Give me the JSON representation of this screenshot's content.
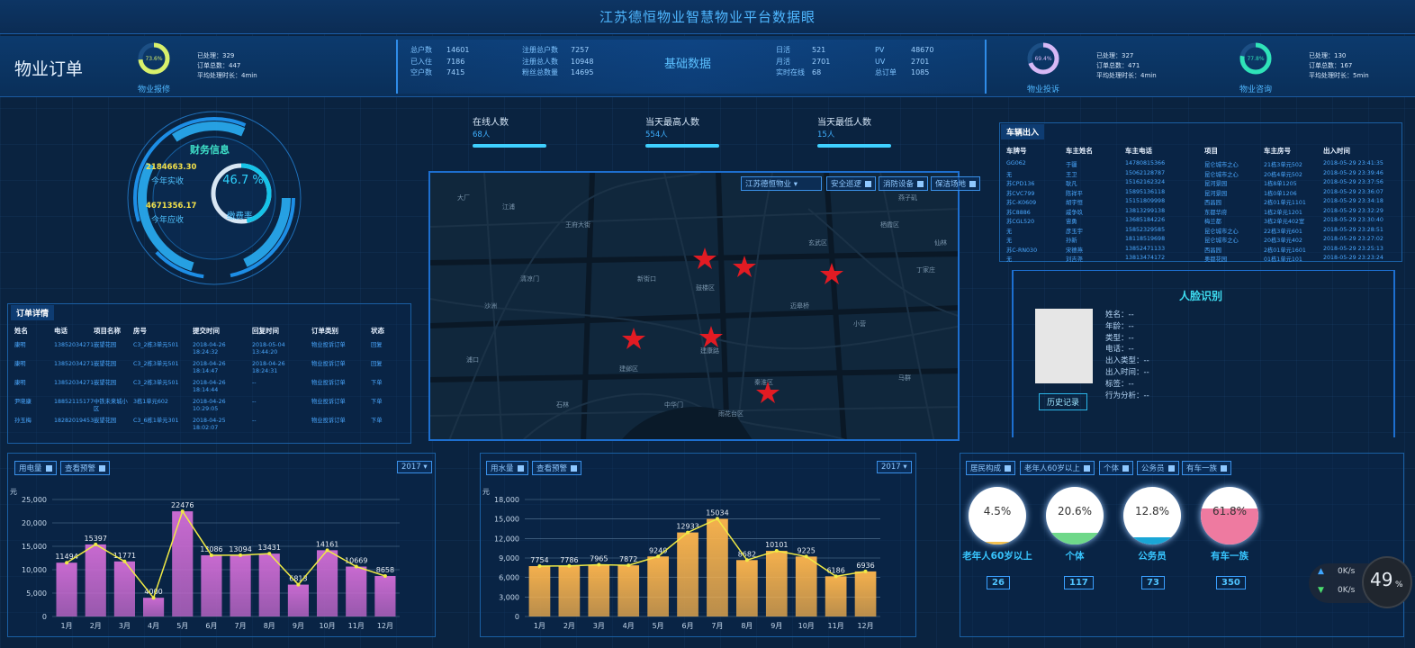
{
  "title": "江苏德恒物业智慧物业平台数据眼",
  "header": {
    "section_title": "物业订单",
    "repair": {
      "pct_text": "73.6%",
      "pct": 0.736,
      "label": "物业报修",
      "color": "#d8f06b",
      "lines": [
        "已处理：329",
        "订单总数：447",
        "平均处理时长：4min"
      ]
    },
    "complaint": {
      "pct_text": "69.4%",
      "pct": 0.694,
      "label": "物业投诉",
      "color": "#d7b8f5",
      "lines": [
        "已处理：327",
        "订单总数：471",
        "平均处理时长：4min"
      ]
    },
    "consult": {
      "pct_text": "77.8%",
      "pct": 0.778,
      "label": "物业咨询",
      "color": "#2fe3b8",
      "lines": [
        "已处理：130",
        "订单总数：167",
        "平均处理时长：5min"
      ]
    },
    "basic_title": "基础数据",
    "basic_col1": [
      [
        "总户数",
        "14601"
      ],
      [
        "已入住",
        "7186"
      ],
      [
        "空户数",
        "7415"
      ]
    ],
    "basic_col2": [
      [
        "注册总户数",
        "7257"
      ],
      [
        "注册总人数",
        "10948"
      ],
      [
        "粉丝总数量",
        "14695"
      ]
    ],
    "basic_col3": [
      [
        "日活",
        "521"
      ],
      [
        "月活",
        "2701"
      ],
      [
        "实时在线",
        "68"
      ]
    ],
    "basic_col4": [
      [
        "PV",
        "48670"
      ],
      [
        "UV",
        "2701"
      ],
      [
        "总订单",
        "1085"
      ]
    ]
  },
  "finance": {
    "title": "财务信息",
    "actual_value": "2184663.30",
    "actual_label": "今年实收",
    "due_value": "4671356.17",
    "due_label": "今年应收",
    "rate": "46.7 %",
    "rate_value": 0.467,
    "rate_label": "缴费率"
  },
  "orders": {
    "title": "订单详情",
    "headers": [
      "姓名",
      "电话",
      "项目名称",
      "房号",
      "提交时间",
      "回复时间",
      "订单类别",
      "状态"
    ],
    "rows": [
      [
        "康明",
        "13852034271",
        "嵌望花园",
        "C3_2栋3单元501",
        "2018-04-26 18:24:32",
        "2018-05-04 13:44:20",
        "物业投诉订单",
        "回复"
      ],
      [
        "康明",
        "13852034271",
        "嵌望花园",
        "C3_2栋3单元501",
        "2018-04-26 18:14:47",
        "2018-04-26 18:24:31",
        "物业投诉订单",
        "回复"
      ],
      [
        "康明",
        "13852034271",
        "嵌望花园",
        "C3_2栋3单元501",
        "2018-04-26 18:14:44",
        "--",
        "物业投诉订单",
        "下单"
      ],
      [
        "尹晓康",
        "18852115177",
        "中铁未来城小区",
        "3栋1单元602",
        "2018-04-26 10:29:05",
        "--",
        "物业投诉订单",
        "下单"
      ],
      [
        "孙玉梅",
        "18282019453",
        "嵌望花园",
        "C3_6栋1单元301",
        "2018-04-25 18:02:07",
        "--",
        "物业投诉订单",
        "下单"
      ]
    ]
  },
  "online": {
    "items": [
      {
        "label": "在线人数",
        "value": "68人"
      },
      {
        "label": "当天最高人数",
        "value": "554人"
      },
      {
        "label": "当天最低人数",
        "value": "15人"
      }
    ]
  },
  "map": {
    "select": "江苏德恒物业",
    "btns": [
      "安全巡逻",
      "消防设备",
      "保洁场地"
    ],
    "labels": [
      "鼓楼区",
      "玄武区",
      "建邺区",
      "秦淮区",
      "雨花台区",
      "栖霞区",
      "王府大街",
      "沙洲",
      "中华门",
      "小营",
      "丁家庄",
      "燕子矶",
      "大厂",
      "清凉门",
      "新街口",
      "建康路",
      "石林",
      "迈皋桥",
      "马群",
      "仙林",
      "浦口",
      "江浦"
    ]
  },
  "vehicles": {
    "title": "车辆出入",
    "headers": [
      "车牌号",
      "车主姓名",
      "车主电话",
      "项目",
      "车主房号",
      "出入时间"
    ],
    "rows": [
      [
        "GG062",
        "于疆",
        "14780815366",
        "昆仑城市之心",
        "21栋3单元502",
        "2018-05-29 23:41:35"
      ],
      [
        "无",
        "王卫",
        "15062128787",
        "昆仑城市之心",
        "20栋4单元502",
        "2018-05-29 23:39:46"
      ],
      [
        "苏CPD136",
        "耿凡",
        "15162162324",
        "昆河景园",
        "1栋8单1205",
        "2018-05-29 23:37:56"
      ],
      [
        "苏CVC799",
        "陈祥平",
        "15895136118",
        "昆河景园",
        "1栋0单1206",
        "2018-05-29 23:36:07"
      ],
      [
        "苏C-K0609",
        "胡宇恒",
        "15151809998",
        "西昌园",
        "2栋01单元1101",
        "2018-05-29 23:34:18"
      ],
      [
        "苏C8886",
        "戚争玖",
        "13813299138",
        "东都华府",
        "1栋2单元1201",
        "2018-05-29 23:32:29"
      ],
      [
        "苏CGL520",
        "宙勇",
        "13685184226",
        "梅兰都",
        "3栋2单元402室",
        "2018-05-29 23:30:40"
      ],
      [
        "无",
        "彦玉宇",
        "15852329585",
        "昆仑城市之心",
        "22栋3单元601",
        "2018-05-29 23:28:51"
      ],
      [
        "无",
        "孙新",
        "18118519698",
        "昆仑城市之心",
        "20栋3单元402",
        "2018-05-29 23:27:02"
      ],
      [
        "苏C-RN030",
        "宋德燕",
        "13852471133",
        "西昌园",
        "2栋01单元1601",
        "2018-05-29 23:25:13"
      ],
      [
        "无",
        "刘吉尧",
        "13813474172",
        "奥都花园",
        "01栋1单元101",
        "2018-05-29 23:23:24"
      ]
    ]
  },
  "face": {
    "title": "人脸识别",
    "fields": [
      "姓名：--",
      "年龄：--",
      "类型：--",
      "电话：--",
      "出入类型：--",
      "出入时间：--",
      "标签：--",
      "行为分析：--"
    ],
    "history_btn": "历史记录"
  },
  "electric": {
    "tab1": "用电量",
    "tab2": "查看预警",
    "year": "2017",
    "unit": "元"
  },
  "water": {
    "tab1": "用水量",
    "tab2": "查看预警",
    "year": "2017",
    "unit": "元"
  },
  "resident": {
    "tabs": [
      "居民构成",
      "老年人60岁以上",
      "个体",
      "公务员",
      "有车一族"
    ],
    "items": [
      {
        "pct": "4.5%",
        "val": 0.045,
        "name": "老年人60岁以上",
        "count": "26",
        "color": "#f4c14f"
      },
      {
        "pct": "20.6%",
        "val": 0.206,
        "name": "个体",
        "count": "117",
        "color": "#6fd88a"
      },
      {
        "pct": "12.8%",
        "val": 0.128,
        "name": "公务员",
        "count": "73",
        "color": "#1aa6d6"
      },
      {
        "pct": "61.8%",
        "val": 0.618,
        "name": "有车一族",
        "count": "350",
        "color": "#ee7aa0"
      }
    ]
  },
  "net": {
    "up": "0K/s",
    "down": "0K/s",
    "pct": "49",
    "unit": "%"
  },
  "chart_data": [
    {
      "type": "bar",
      "title": "用电量",
      "categories": [
        "1月",
        "2月",
        "3月",
        "4月",
        "5月",
        "6月",
        "7月",
        "8月",
        "9月",
        "10月",
        "11月",
        "12月"
      ],
      "series": [
        {
          "values": [
            11494,
            15397,
            11771,
            4000,
            22476,
            13086,
            13094,
            13431,
            6813,
            14161,
            10669,
            8658
          ]
        }
      ],
      "ylabel": "元",
      "ylim": [
        0,
        25000
      ],
      "yticks": [
        0,
        5000,
        10000,
        15000,
        20000,
        25000
      ],
      "bar_color": "#c86ad0",
      "line_color": "#f0ea45"
    },
    {
      "type": "bar",
      "title": "用水量",
      "categories": [
        "1月",
        "2月",
        "3月",
        "4月",
        "5月",
        "6月",
        "7月",
        "8月",
        "9月",
        "10月",
        "11月",
        "12月"
      ],
      "series": [
        {
          "values": [
            7754,
            7786,
            7965,
            7872,
            9240,
            12933,
            15034,
            8682,
            10101,
            9225,
            6186,
            6936
          ]
        }
      ],
      "ylabel": "元",
      "ylim": [
        0,
        18000
      ],
      "yticks": [
        0,
        3000,
        6000,
        9000,
        12000,
        15000,
        18000
      ],
      "bar_color": "#f4b04d",
      "line_color": "#f0ea45"
    }
  ]
}
